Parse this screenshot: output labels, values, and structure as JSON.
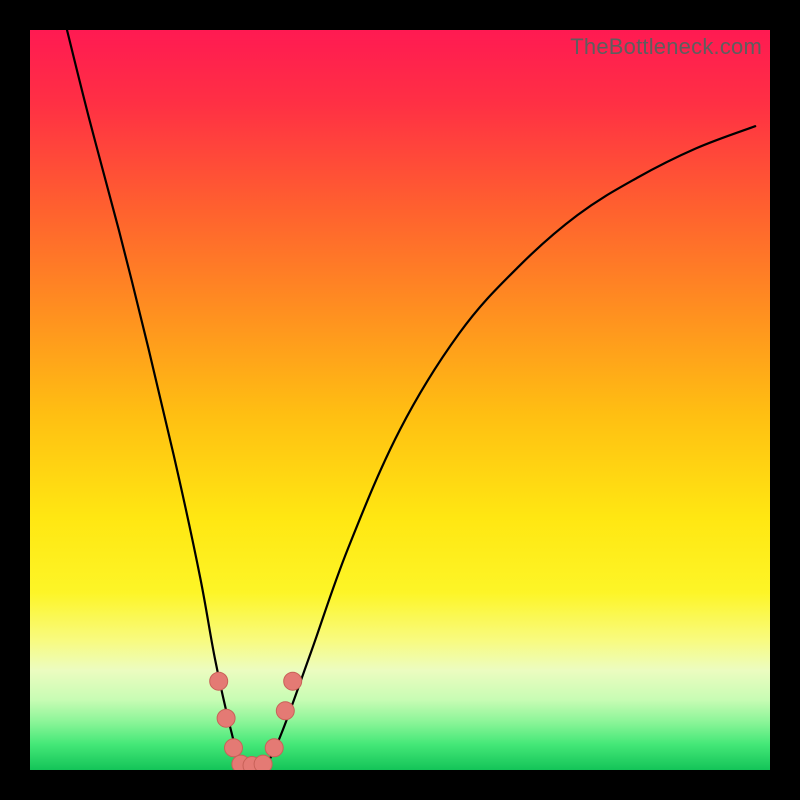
{
  "watermark": "TheBottleneck.com",
  "colors": {
    "frame": "#000000",
    "curve": "#000000",
    "marker_fill": "#e47a74",
    "marker_stroke": "#c86158",
    "gradient_stops": [
      {
        "offset": 0.0,
        "color": "#ff1a52"
      },
      {
        "offset": 0.1,
        "color": "#ff3044"
      },
      {
        "offset": 0.24,
        "color": "#ff602f"
      },
      {
        "offset": 0.38,
        "color": "#ff8f20"
      },
      {
        "offset": 0.52,
        "color": "#ffbf12"
      },
      {
        "offset": 0.66,
        "color": "#ffe712"
      },
      {
        "offset": 0.76,
        "color": "#fdf527"
      },
      {
        "offset": 0.825,
        "color": "#f8fb80"
      },
      {
        "offset": 0.865,
        "color": "#ecfcc0"
      },
      {
        "offset": 0.905,
        "color": "#c8fcb4"
      },
      {
        "offset": 0.935,
        "color": "#8bf598"
      },
      {
        "offset": 0.965,
        "color": "#45e878"
      },
      {
        "offset": 1.0,
        "color": "#13c458"
      }
    ]
  },
  "chart_data": {
    "type": "line",
    "title": "",
    "xlabel": "",
    "ylabel": "",
    "xlim": [
      0,
      100
    ],
    "ylim": [
      0,
      100
    ],
    "series": [
      {
        "name": "bottleneck-curve",
        "x": [
          5,
          8,
          12,
          16,
          20,
          23,
          25,
          27,
          28.5,
          30,
          32,
          34,
          38,
          43,
          50,
          58,
          66,
          74,
          82,
          90,
          98
        ],
        "y": [
          100,
          88,
          73,
          57,
          40,
          26,
          15,
          6,
          1,
          0.5,
          1,
          5,
          16,
          30,
          46,
          59,
          68,
          75,
          80,
          84,
          87
        ]
      }
    ],
    "markers": {
      "name": "highlighted-range",
      "points": [
        {
          "x": 25.5,
          "y": 12
        },
        {
          "x": 26.5,
          "y": 7
        },
        {
          "x": 27.5,
          "y": 3
        },
        {
          "x": 28.5,
          "y": 0.8
        },
        {
          "x": 30.0,
          "y": 0.6
        },
        {
          "x": 31.5,
          "y": 0.8
        },
        {
          "x": 33.0,
          "y": 3
        },
        {
          "x": 34.5,
          "y": 8
        },
        {
          "x": 35.5,
          "y": 12
        }
      ]
    }
  }
}
